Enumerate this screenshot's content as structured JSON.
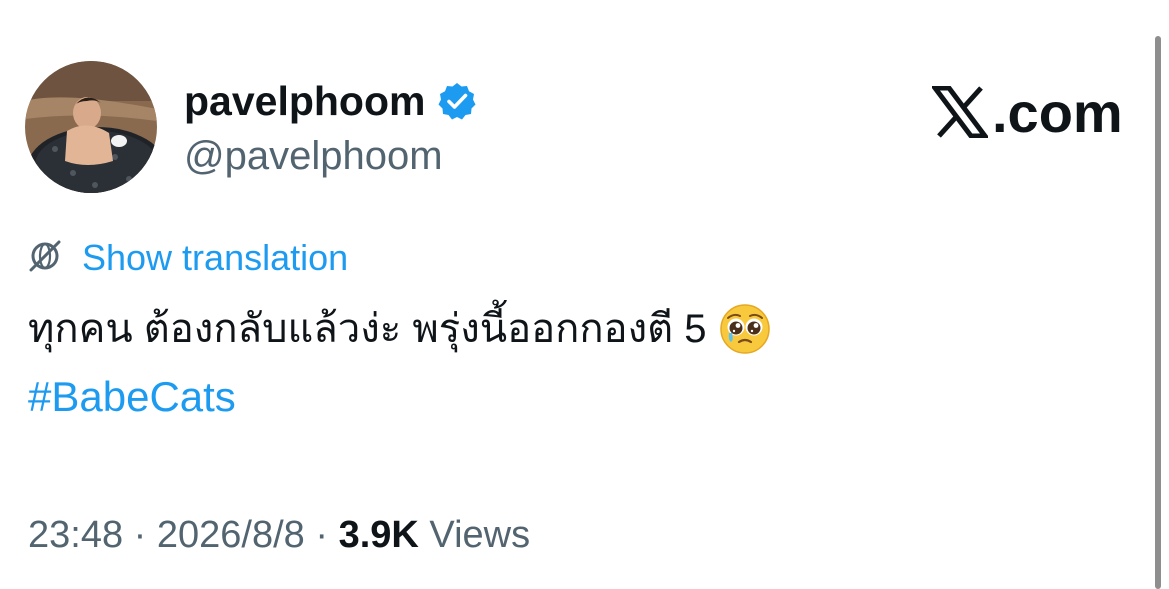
{
  "author": {
    "display_name": "pavelphoom",
    "handle": "@pavelphoom",
    "verified_icon": "verified-badge-icon",
    "avatar_icon": "avatar-photo"
  },
  "site": {
    "logo_icon": "x-logo-icon",
    "logo_text": ".com"
  },
  "translate": {
    "icon": "globe-icon",
    "label": "Show translation"
  },
  "tweet": {
    "text": "ทุกคน ต้องกลับแล้วง่ะ พรุ่งนี้ออกกองตี 5",
    "emoji_icon": "pleading-face-emoji",
    "hashtag": "#BabeCats"
  },
  "meta": {
    "time": "23:48",
    "sep1": " · ",
    "date": "2026/8/8",
    "sep2": " · ",
    "views_count": "3.9K",
    "views_label": " Views"
  },
  "colors": {
    "text_primary": "#0f1419",
    "text_secondary": "#536471",
    "link_blue": "#1d9bf0"
  }
}
